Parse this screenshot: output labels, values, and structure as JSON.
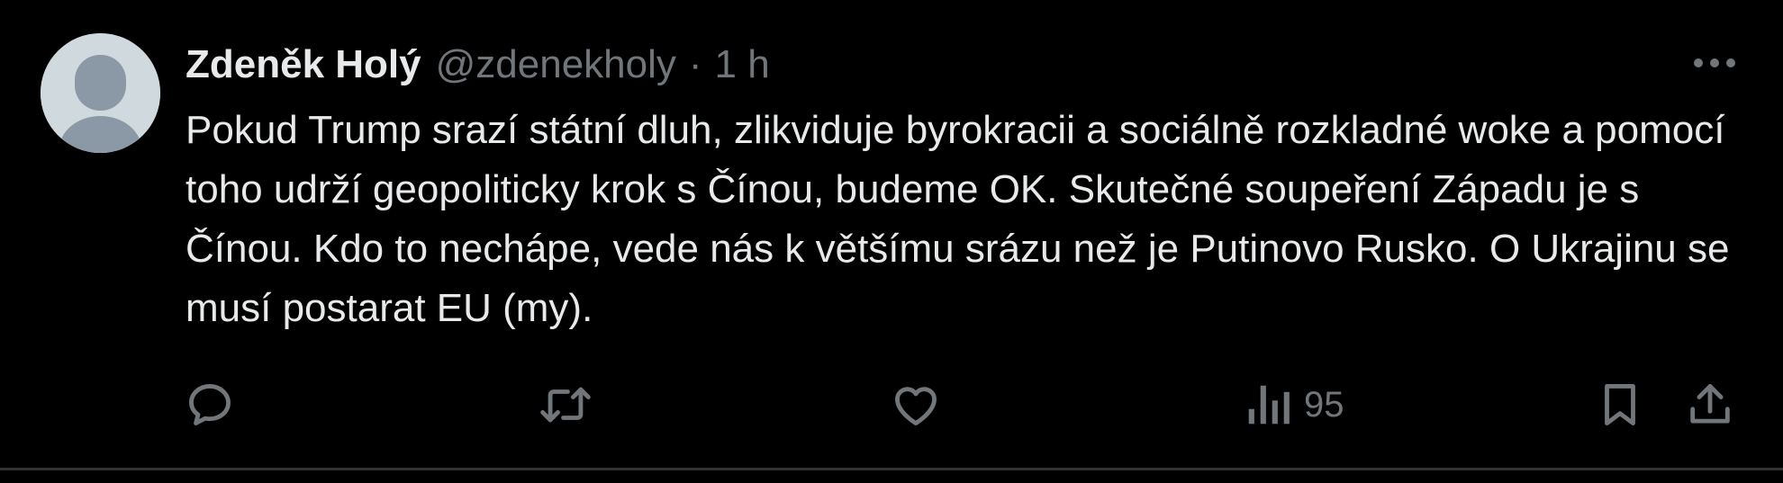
{
  "tweet": {
    "author_name": "Zdeněk Holý",
    "handle": "@zdenekholy",
    "separator": "·",
    "time": "1 h",
    "text": "Pokud Trump srazí státní dluh, zlikviduje byrokracii a sociálně rozkladné woke a pomocí toho udrží geopoliticky krok s Čínou, budeme OK. Skutečné soupeření Západu je s Čínou. Kdo to nechápe, vede nás k většímu srázu než je Putinovo Rusko. O Ukrajinu se musí postarat EU (my)."
  },
  "actions": {
    "views_count": "95",
    "icons": [
      "reply-icon",
      "retweet-icon",
      "like-icon",
      "views-icon",
      "bookmark-icon",
      "share-icon"
    ]
  },
  "colors": {
    "background": "#000000",
    "text_primary": "#e7e9ea",
    "text_secondary": "#71767b",
    "avatar_bg": "#cfd9de",
    "avatar_fg": "#8b98a5",
    "divider": "#2f3336"
  }
}
